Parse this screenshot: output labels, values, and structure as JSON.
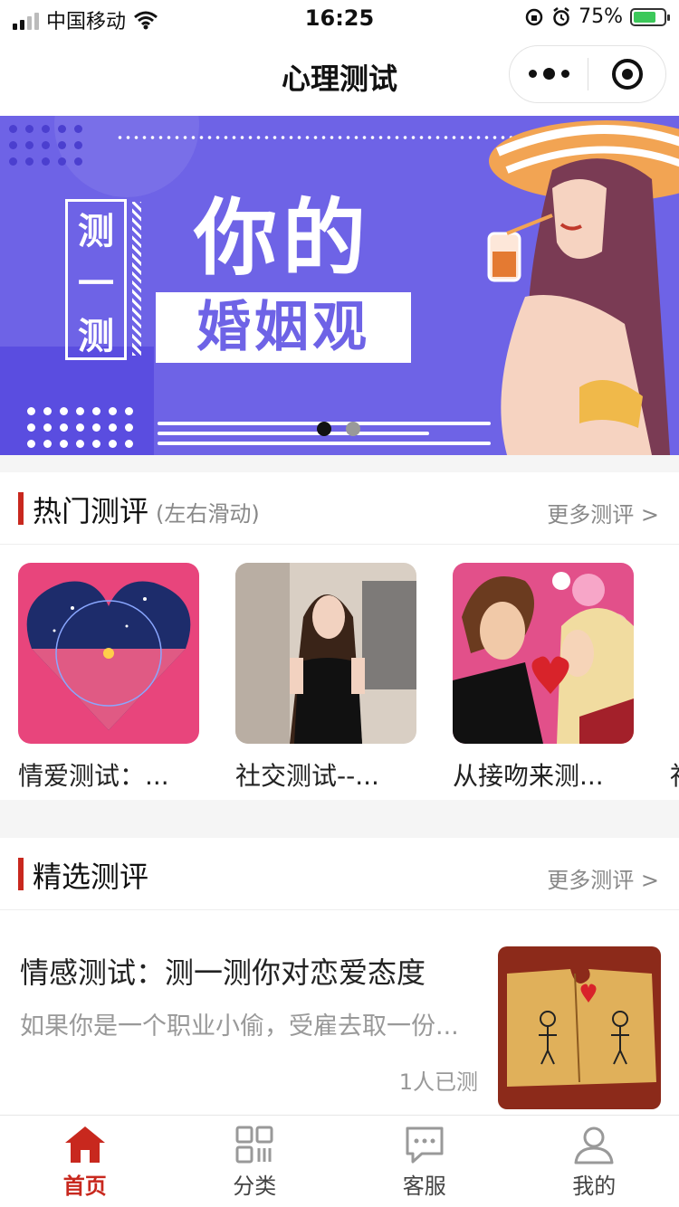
{
  "status_bar": {
    "carrier": "中国移动",
    "time": "16:25",
    "battery": "75%"
  },
  "nav": {
    "title": "心理测试"
  },
  "banner": {
    "tag_chars": [
      "测",
      "一",
      "测"
    ],
    "headline": "你的",
    "subline": "婚姻观",
    "slide_count": 2,
    "active_slide": 1
  },
  "hot": {
    "title": "热门测评",
    "subtitle": "(左右滑动)",
    "more": "更多测评 >",
    "items": [
      {
        "name": "情爱测试：..."
      },
      {
        "name": "社交测试--..."
      },
      {
        "name": "从接吻来测..."
      },
      {
        "name": "社"
      }
    ]
  },
  "featured": {
    "title": "精选测评",
    "more": "更多测评 >",
    "items": [
      {
        "title": "情感测试：测一测你对恋爱态度",
        "desc": "如果你是一个职业小偷，受雇去取一份...",
        "count": "1人已测"
      }
    ]
  },
  "tabbar": {
    "active_color": "#c8281e",
    "tabs": [
      {
        "label": "首页",
        "icon": "home-icon",
        "active": true
      },
      {
        "label": "分类",
        "icon": "grid-icon",
        "active": false
      },
      {
        "label": "客服",
        "icon": "chat-icon",
        "active": false
      },
      {
        "label": "我的",
        "icon": "user-icon",
        "active": false
      }
    ]
  }
}
